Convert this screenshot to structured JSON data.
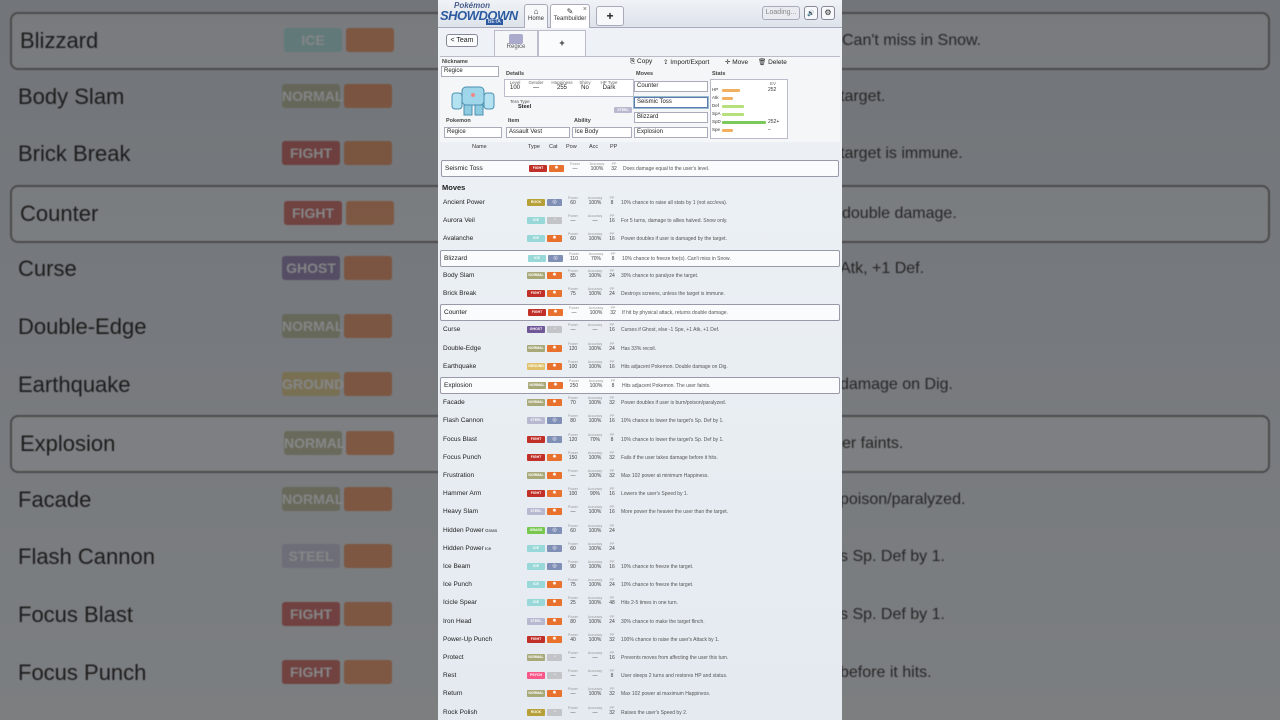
{
  "colors": {
    "Normal": "#a8a878",
    "Fighting": "#c03028",
    "Ice": "#98d8d8",
    "Ghost": "#705898",
    "Ground": "#e0c068",
    "Steel": "#b8b8d0",
    "Grass": "#78c850",
    "Psychic": "#f85888",
    "accent": "#2c5aa0"
  },
  "topbar": {
    "logo_top": "Pokémon",
    "logo_main": "SHOWDOWN",
    "logo_badge": "BETA",
    "home_label": "Home",
    "home_icon": "home-icon",
    "teambuilder_label": "Teambuilder",
    "teambuilder_icon": "edit-icon",
    "close_glyph": "×",
    "new_tab_glyph": "+",
    "loading": "Loading...",
    "sound_glyph": "🔊",
    "settings_glyph": "⚙"
  },
  "team": {
    "back_label": "Team",
    "back_glyph": "<",
    "slot_label": "Regice",
    "add_glyph": "+"
  },
  "editor": {
    "nickname_label": "Nickname",
    "nickname": "Regice",
    "details_label": "Details",
    "level_label": "Level",
    "level": "100",
    "gender_label": "Gender",
    "gender": "—",
    "happiness_label": "Happiness",
    "happiness": "255",
    "shiny_label": "Shiny",
    "shiny": "No",
    "hptype_label": "HP Type",
    "hptype": "Dark",
    "tera_label": "Tera Type",
    "tera": "Steel",
    "tera_badge": "STEEL",
    "pokemon_label": "Pokemon",
    "pokemon": "Regice",
    "item_label": "Item",
    "item": "Assault Vest",
    "ability_label": "Ability",
    "ability": "Ice Body",
    "copy_label": "Copy",
    "import_label": "Import/Export",
    "move_label": "Move",
    "delete_label": "Delete",
    "moves_label": "Moves",
    "moves": [
      "Counter",
      "Seismic Toss",
      "Blizzard",
      "Explosion"
    ],
    "stats_label": "Stats",
    "ev_label": "EV",
    "stats": [
      {
        "name": "HP",
        "base": 80,
        "ev": "252"
      },
      {
        "name": "Atk",
        "base": 50,
        "ev": ""
      },
      {
        "name": "Def",
        "base": 100,
        "ev": ""
      },
      {
        "name": "SpA",
        "base": 100,
        "ev": ""
      },
      {
        "name": "SpD",
        "base": 200,
        "ev": "252+"
      },
      {
        "name": "Spe",
        "base": 50,
        "ev": "–"
      }
    ]
  },
  "list": {
    "headers": {
      "name": "Name",
      "type": "Type",
      "cat": "Cat",
      "pow": "Pow",
      "acc": "Acc",
      "pp": "PP"
    },
    "sub_power": "Power",
    "sub_accuracy": "Accuracy",
    "sub_pp": "PP",
    "current": {
      "name": "Seismic Toss",
      "type": "Fighting",
      "cat": "physical",
      "power": "—",
      "acc": "100%",
      "pp": "32",
      "desc": "Does damage equal to the user's level."
    },
    "section": "Moves",
    "moves": [
      {
        "name": "Ancient Power",
        "type": "Rock",
        "cat": "special",
        "power": "60",
        "acc": "100%",
        "pp": "8",
        "desc": "10% chance to raise all stats by 1 (not acc/eva)."
      },
      {
        "name": "Aurora Veil",
        "type": "Ice",
        "cat": "status",
        "power": "—",
        "acc": "—",
        "pp": "16",
        "desc": "For 5 turns, damage to allies halved. Snow only."
      },
      {
        "name": "Avalanche",
        "type": "Ice",
        "cat": "physical",
        "power": "60",
        "acc": "100%",
        "pp": "16",
        "desc": "Power doubles if user is damaged by the target."
      },
      {
        "name": "Blizzard",
        "type": "Ice",
        "cat": "special",
        "power": "110",
        "acc": "70%",
        "pp": "8",
        "desc": "10% chance to freeze foe(s). Can't miss in Snow.",
        "selected": true
      },
      {
        "name": "Body Slam",
        "type": "Normal",
        "cat": "physical",
        "power": "85",
        "acc": "100%",
        "pp": "24",
        "desc": "30% chance to paralyze the target."
      },
      {
        "name": "Brick Break",
        "type": "Fighting",
        "cat": "physical",
        "power": "75",
        "acc": "100%",
        "pp": "24",
        "desc": "Destroys screens, unless the target is immune."
      },
      {
        "name": "Counter",
        "type": "Fighting",
        "cat": "physical",
        "power": "—",
        "acc": "100%",
        "pp": "32",
        "desc": "If hit by physical attack, returns double damage.",
        "selected": true
      },
      {
        "name": "Curse",
        "type": "Ghost",
        "cat": "status",
        "power": "—",
        "acc": "—",
        "pp": "16",
        "desc": "Curses if Ghost, else -1 Spe, +1 Atk, +1 Def."
      },
      {
        "name": "Double-Edge",
        "type": "Normal",
        "cat": "physical",
        "power": "120",
        "acc": "100%",
        "pp": "24",
        "desc": "Has 33% recoil."
      },
      {
        "name": "Earthquake",
        "type": "Ground",
        "cat": "physical",
        "power": "100",
        "acc": "100%",
        "pp": "16",
        "desc": "Hits adjacent Pokemon. Double damage on Dig."
      },
      {
        "name": "Explosion",
        "type": "Normal",
        "cat": "physical",
        "power": "250",
        "acc": "100%",
        "pp": "8",
        "desc": "Hits adjacent Pokemon. The user faints.",
        "selected": true
      },
      {
        "name": "Facade",
        "type": "Normal",
        "cat": "physical",
        "power": "70",
        "acc": "100%",
        "pp": "32",
        "desc": "Power doubles if user is burn/poison/paralyzed."
      },
      {
        "name": "Flash Cannon",
        "type": "Steel",
        "cat": "special",
        "power": "80",
        "acc": "100%",
        "pp": "16",
        "desc": "10% chance to lower the target's Sp. Def by 1."
      },
      {
        "name": "Focus Blast",
        "type": "Fighting",
        "cat": "special",
        "power": "120",
        "acc": "70%",
        "pp": "8",
        "desc": "10% chance to lower the target's Sp. Def by 1."
      },
      {
        "name": "Focus Punch",
        "type": "Fighting",
        "cat": "physical",
        "power": "150",
        "acc": "100%",
        "pp": "32",
        "desc": "Fails if the user takes damage before it hits."
      },
      {
        "name": "Frustration",
        "type": "Normal",
        "cat": "physical",
        "power": "—",
        "acc": "100%",
        "pp": "32",
        "desc": "Max 102 power at minimum Happiness."
      },
      {
        "name": "Hammer Arm",
        "type": "Fighting",
        "cat": "physical",
        "power": "100",
        "acc": "90%",
        "pp": "16",
        "desc": "Lowers the user's Speed by 1."
      },
      {
        "name": "Heavy Slam",
        "type": "Steel",
        "cat": "physical",
        "power": "—",
        "acc": "100%",
        "pp": "16",
        "desc": "More power the heavier the user than the target."
      },
      {
        "name": "Hidden Power",
        "suffix": "Grass",
        "type": "Grass",
        "cat": "special",
        "power": "60",
        "acc": "100%",
        "pp": "24",
        "desc": ""
      },
      {
        "name": "Hidden Power",
        "suffix": "Ice",
        "type": "Ice",
        "cat": "special",
        "power": "60",
        "acc": "100%",
        "pp": "24",
        "desc": ""
      },
      {
        "name": "Ice Beam",
        "type": "Ice",
        "cat": "special",
        "power": "90",
        "acc": "100%",
        "pp": "16",
        "desc": "10% chance to freeze the target."
      },
      {
        "name": "Ice Punch",
        "type": "Ice",
        "cat": "physical",
        "power": "75",
        "acc": "100%",
        "pp": "24",
        "desc": "10% chance to freeze the target."
      },
      {
        "name": "Icicle Spear",
        "type": "Ice",
        "cat": "physical",
        "power": "25",
        "acc": "100%",
        "pp": "48",
        "desc": "Hits 2-5 times in one turn."
      },
      {
        "name": "Iron Head",
        "type": "Steel",
        "cat": "physical",
        "power": "80",
        "acc": "100%",
        "pp": "24",
        "desc": "30% chance to make the target flinch."
      },
      {
        "name": "Power-Up Punch",
        "type": "Fighting",
        "cat": "physical",
        "power": "40",
        "acc": "100%",
        "pp": "32",
        "desc": "100% chance to raise the user's Attack by 1."
      },
      {
        "name": "Protect",
        "type": "Normal",
        "cat": "status",
        "power": "—",
        "acc": "—",
        "pp": "16",
        "desc": "Prevents moves from affecting the user this turn."
      },
      {
        "name": "Rest",
        "type": "Psychic",
        "cat": "status",
        "power": "—",
        "acc": "—",
        "pp": "8",
        "desc": "User sleeps 2 turns and restores HP and status."
      },
      {
        "name": "Return",
        "type": "Normal",
        "cat": "physical",
        "power": "—",
        "acc": "100%",
        "pp": "32",
        "desc": "Max 102 power at maximum Happiness."
      },
      {
        "name": "Rock Polish",
        "type": "Rock",
        "cat": "status",
        "power": "—",
        "acc": "—",
        "pp": "32",
        "desc": "Raises the user's Speed by 2."
      }
    ]
  },
  "type_badges": {
    "Normal": "NORMAL",
    "Fighting": "FIGHT",
    "Ice": "ICE",
    "Ghost": "GHOST",
    "Ground": "GROUND",
    "Steel": "STEEL",
    "Grass": "GRASS",
    "Psychic": "PSYCH",
    "Rock": "ROCK"
  },
  "backdrop": [
    {
      "name": "Blizzard",
      "type": "ICE",
      "desc": "Can't miss in Snow.",
      "sel": true
    },
    {
      "name": "Body Slam",
      "type": "NORMAL",
      "desc": "target.",
      "sel": false
    },
    {
      "name": "Brick Break",
      "type": "FIGHT",
      "desc": "target is immune.",
      "sel": false
    },
    {
      "name": "Counter",
      "type": "FIGHT",
      "desc": "double damage.",
      "sel": true
    },
    {
      "name": "Curse",
      "type": "GHOST",
      "desc": "Atk, +1 Def.",
      "sel": false
    },
    {
      "name": "Double-Edge",
      "type": "NORMAL",
      "desc": "",
      "sel": false
    },
    {
      "name": "Earthquake",
      "type": "GROUND",
      "desc": "damage on Dig.",
      "sel": false
    },
    {
      "name": "Explosion",
      "type": "NORMAL",
      "desc": "er faints.",
      "sel": true
    },
    {
      "name": "Facade",
      "type": "NORMAL",
      "desc": "poison/paralyzed.",
      "sel": false
    },
    {
      "name": "Flash Cannon",
      "type": "STEEL",
      "desc": "s Sp. Def by 1.",
      "sel": false
    },
    {
      "name": "Focus Blast",
      "type": "FIGHT",
      "desc": "s Sp. Def by 1.",
      "sel": false
    },
    {
      "name": "Focus Punch",
      "type": "FIGHT",
      "desc": "before it hits.",
      "sel": false
    }
  ]
}
